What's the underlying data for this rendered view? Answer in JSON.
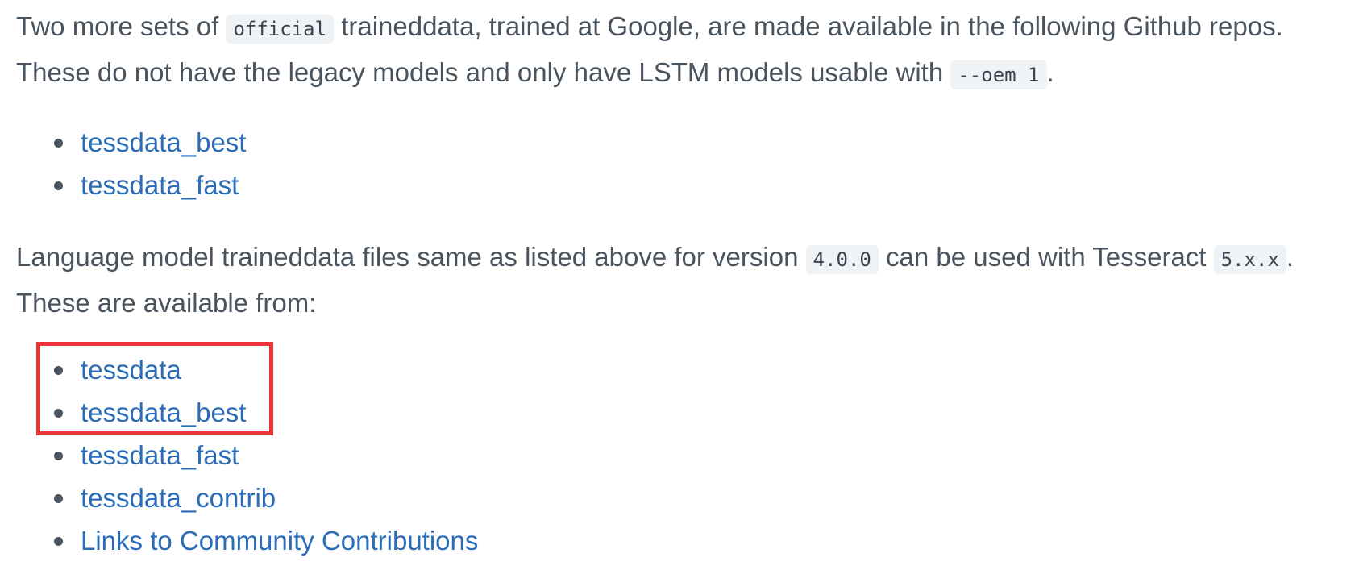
{
  "paragraph1": {
    "part1": "Two more sets of ",
    "code1": "official",
    "part2": " traineddata, trained at Google, are made available in the following Github repos. These do not have the legacy models and only have LSTM models usable with ",
    "code2": "--oem 1",
    "part3": "."
  },
  "list1": [
    {
      "label": "tessdata_best"
    },
    {
      "label": "tessdata_fast"
    }
  ],
  "paragraph2": {
    "part1": "Language model traineddata files same as listed above for version ",
    "code1": "4.0.0",
    "part2": " can be used with Tesseract ",
    "code2": "5.x.x",
    "part3": ". These are available from:"
  },
  "list2": [
    {
      "label": "tessdata"
    },
    {
      "label": "tessdata_best"
    },
    {
      "label": "tessdata_fast"
    },
    {
      "label": "tessdata_contrib"
    },
    {
      "label": "Links to Community Contributions"
    }
  ],
  "colors": {
    "text": "#4a545e",
    "link": "#2a6cb7",
    "highlight": "#e8363a",
    "code_bg": "#f0f3f6"
  }
}
